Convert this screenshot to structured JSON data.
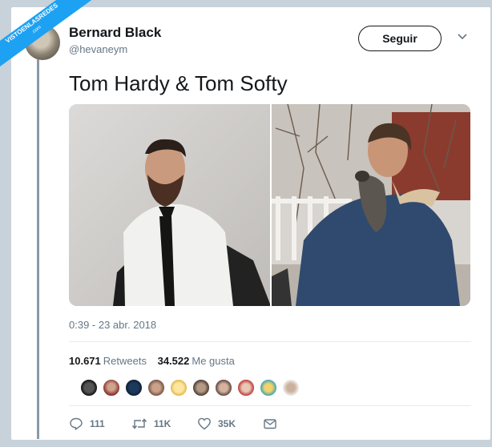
{
  "watermark": {
    "brand": "VISTOENLASREDES",
    "tld": ".com"
  },
  "profile": {
    "name": "Bernard Black",
    "handle": "@hevaneym"
  },
  "follow_label": "Seguir",
  "tweet": {
    "text": "Tom Hardy & Tom Softy",
    "timestamp": "0:39 - 23 abr. 2018"
  },
  "stats": {
    "retweets_count": "10.671",
    "retweets_label": "Retweets",
    "likes_count": "34.522",
    "likes_label": "Me gusta"
  },
  "actions": {
    "replies": "111",
    "retweets": "11K",
    "likes": "35K"
  },
  "colors": {
    "accent": "#1da1f2",
    "text": "#14171a",
    "muted": "#657786"
  }
}
